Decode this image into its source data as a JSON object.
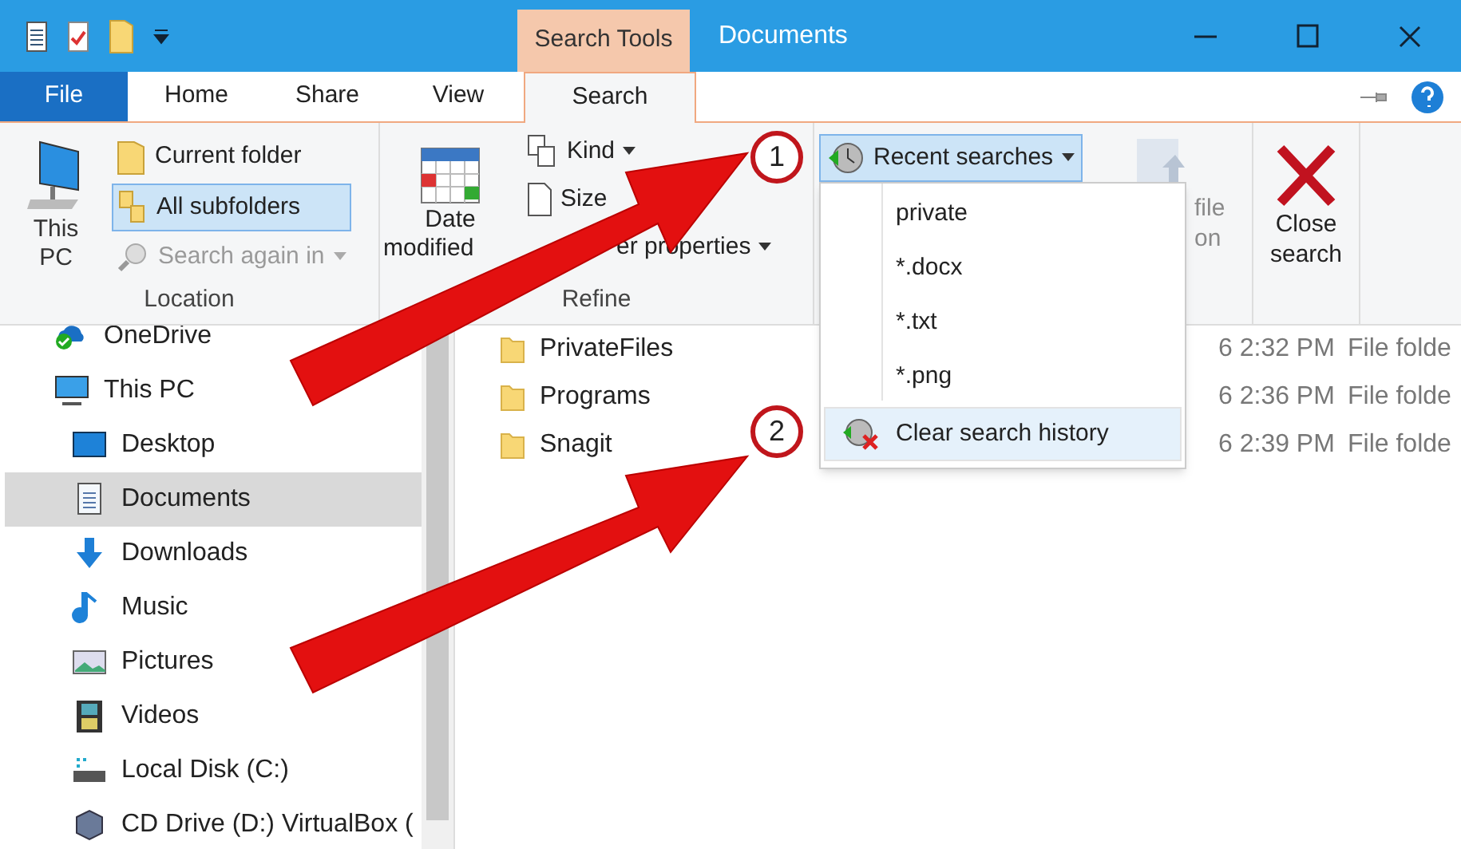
{
  "window": {
    "title": "Documents",
    "context_tab_group": "Search Tools"
  },
  "tabs": [
    {
      "label": "File",
      "kind": "file",
      "selected": false
    },
    {
      "label": "Home",
      "kind": "normal",
      "selected": false
    },
    {
      "label": "Share",
      "kind": "normal",
      "selected": false
    },
    {
      "label": "View",
      "kind": "normal",
      "selected": false
    },
    {
      "label": "Search",
      "kind": "context",
      "selected": true
    }
  ],
  "ribbon": {
    "location": {
      "label": "Location",
      "this_pc": [
        "This",
        "PC"
      ],
      "current_folder": "Current folder",
      "all_subfolders": {
        "label": "All subfolders",
        "selected": true
      },
      "search_again": {
        "label": "Search again in",
        "disabled": true
      }
    },
    "refine": {
      "label": "Refine",
      "date_modified": [
        "Date",
        "modified"
      ],
      "kind": "Kind",
      "size": "Size",
      "other_properties": "er properties"
    },
    "recent_searches": {
      "label": "Recent searches",
      "expanded": true
    },
    "open_file_location": {
      "fragments": [
        "file",
        "on"
      ],
      "disabled": true
    },
    "close_search": [
      "Close",
      "search"
    ]
  },
  "recent_menu": [
    {
      "label": "private",
      "kind": "entry",
      "selected": false
    },
    {
      "label": "*.docx",
      "kind": "entry",
      "selected": false
    },
    {
      "label": "*.txt",
      "kind": "entry",
      "selected": false
    },
    {
      "label": "*.png",
      "kind": "entry",
      "selected": false
    },
    {
      "label": "Clear search history",
      "kind": "clear",
      "selected": true
    }
  ],
  "navigation": [
    {
      "label": "OneDrive",
      "selected": false
    },
    {
      "label": "This PC",
      "selected": false,
      "children": [
        {
          "label": "Desktop",
          "selected": false
        },
        {
          "label": "Documents",
          "selected": true
        },
        {
          "label": "Downloads",
          "selected": false
        },
        {
          "label": "Music",
          "selected": false
        },
        {
          "label": "Pictures",
          "selected": false
        },
        {
          "label": "Videos",
          "selected": false
        },
        {
          "label": "Local Disk (C:)",
          "selected": false
        },
        {
          "label": "CD Drive (D:) VirtualBox (",
          "selected": false
        }
      ]
    }
  ],
  "files": [
    {
      "name": "PrivateFiles",
      "date": "6 2:32 PM",
      "type": "File folde"
    },
    {
      "name": "Programs",
      "date": "6 2:36 PM",
      "type": "File folde"
    },
    {
      "name": "Snagit",
      "date": "6 2:39 PM",
      "type": "File folde"
    }
  ],
  "annotations": [
    {
      "label": "1"
    },
    {
      "label": "2"
    }
  ]
}
